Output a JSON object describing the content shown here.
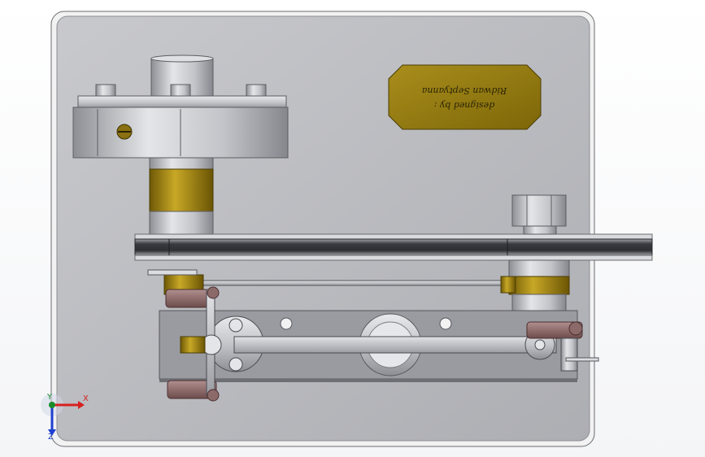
{
  "viewport": {
    "background_top": "#ffffff",
    "background_bottom": "#f4f5f7"
  },
  "colors": {
    "base_plate": "#b8b9bd",
    "brass": "#9a7c0c",
    "belt": "#3a3b40",
    "steel": "#c9cace",
    "dark_steel": "#7d7e84",
    "bracket": "#8c6a6a",
    "nameplate": "#8c7410"
  },
  "nameplate": {
    "line1": "designed by :",
    "line2": "Ridwan Septyanna"
  },
  "triad": {
    "x_label": "X",
    "y_label": "Y",
    "z_label": "Z",
    "x_color": "#d62020",
    "y_color": "#1a8c2a",
    "z_color": "#1e3fd0"
  }
}
